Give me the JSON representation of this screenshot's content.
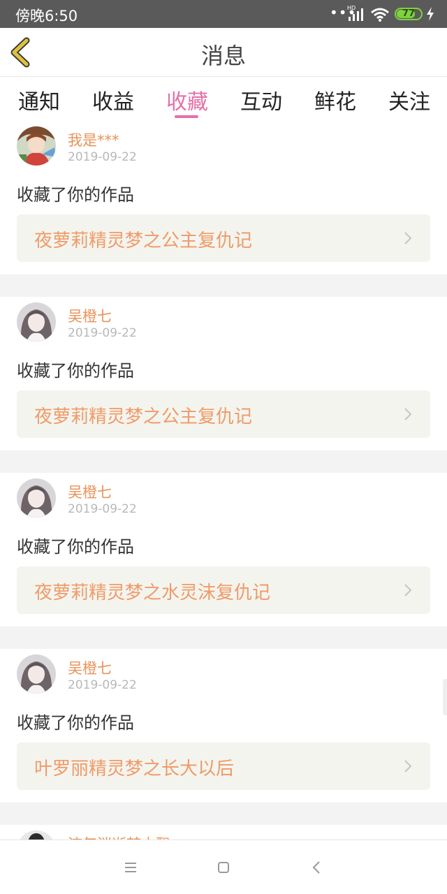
{
  "status_bar": {
    "time": "傍晚6:50",
    "network": "HD",
    "battery": "77",
    "battery_level": 0.77
  },
  "header": {
    "title": "消息",
    "back_icon": "chevron-left-icon"
  },
  "tabs": [
    {
      "label": "通知"
    },
    {
      "label": "收益"
    },
    {
      "label": "收藏",
      "active": true
    },
    {
      "label": "互动"
    },
    {
      "label": "鲜花"
    },
    {
      "label": "关注"
    }
  ],
  "items": [
    {
      "user": "我是***",
      "date": "2019-09-22",
      "action": "收藏了你的作品",
      "work": "夜萝莉精灵梦之公主复仇记",
      "avatar": "anime-avatar"
    },
    {
      "user": "吴橙七",
      "date": "2019-09-22",
      "action": "收藏了你的作品",
      "work": "夜萝莉精灵梦之公主复仇记",
      "avatar": "girl-avatar"
    },
    {
      "user": "吴橙七",
      "date": "2019-09-22",
      "action": "收藏了你的作品",
      "work": "夜萝莉精灵梦之水灵沫复仇记",
      "avatar": "girl-avatar"
    },
    {
      "user": "吴橙七",
      "date": "2019-09-22",
      "action": "收藏了你的作品",
      "work": "叶罗丽精灵梦之长大以后",
      "avatar": "girl-avatar"
    },
    {
      "user": "流年消逝梦中飘",
      "avatar": "dark-avatar"
    }
  ],
  "nav": {
    "menu_icon": "menu-icon",
    "home_icon": "square-icon",
    "back_icon": "back-triangle-icon"
  },
  "colors": {
    "accent": "#e66fa8",
    "username": "#e8935a",
    "work_title": "#ef9b67",
    "work_bg": "#f4f4ef",
    "back_arrow": "#e0c33a"
  }
}
